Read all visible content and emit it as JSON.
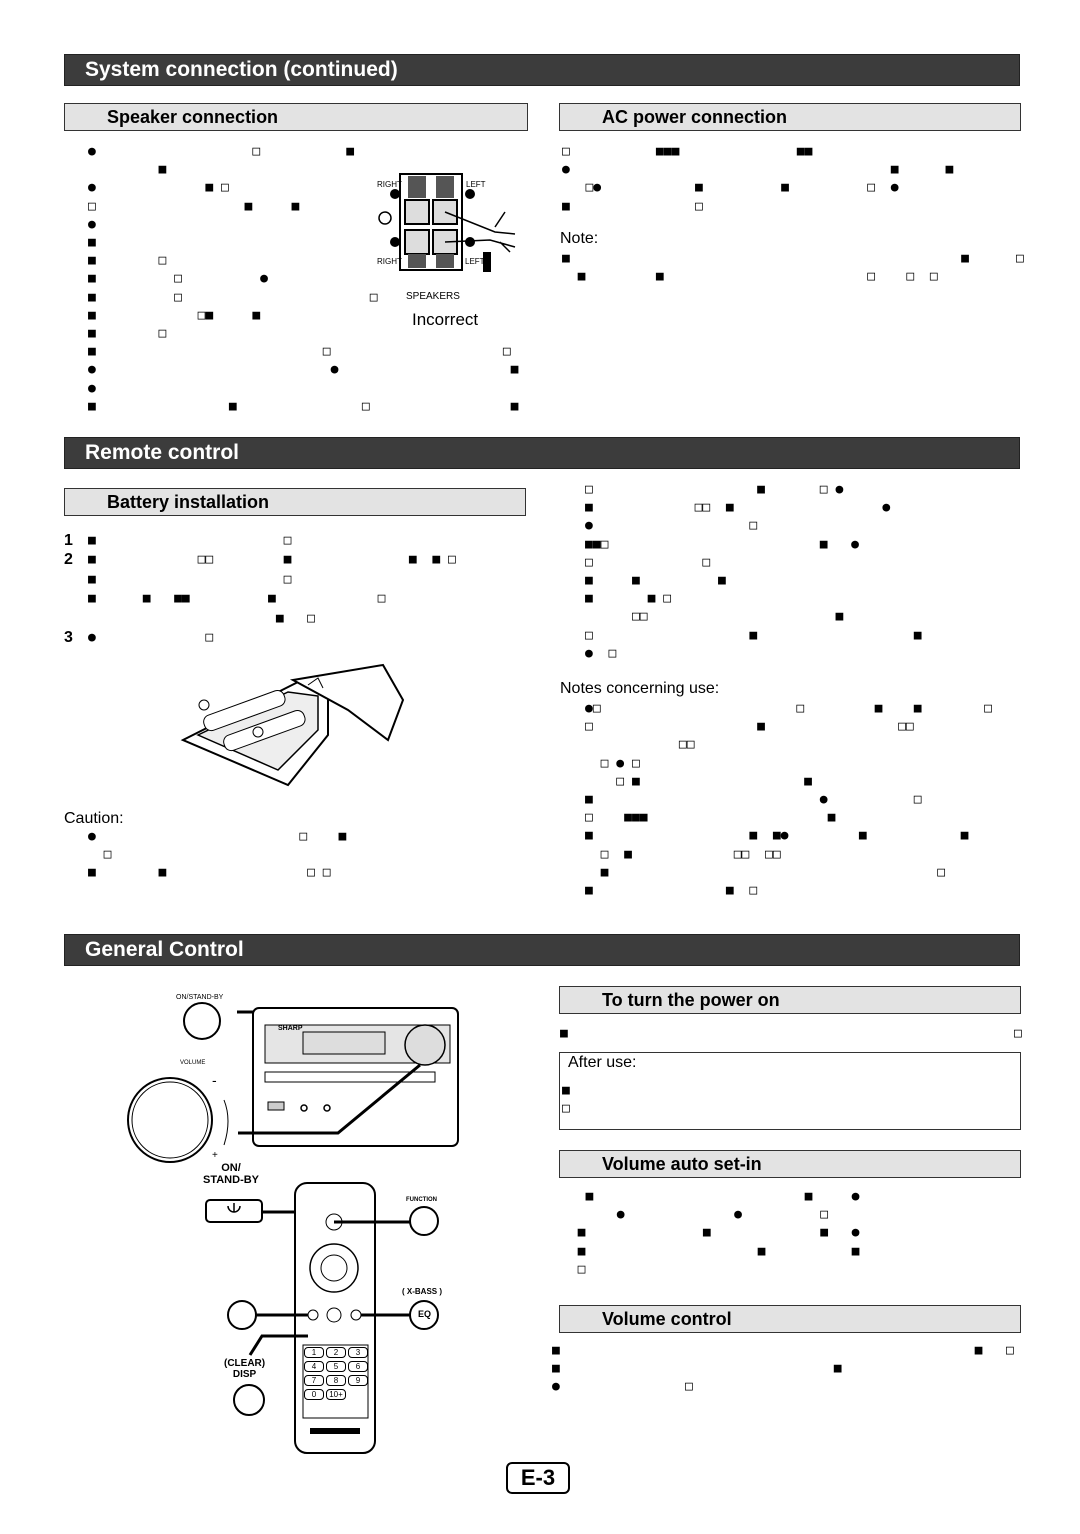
{
  "sections": {
    "system_connection": {
      "title": "System connection (continued)",
      "speaker": {
        "title": "Speaker connection",
        "lines": [
          "●                    □           ■",
          "         ■",
          "●              ■ □",
          "□                   ■     ■",
          "●",
          "■",
          "■        □",
          "■          □          ●",
          "■          □                        □",
          "■             □■     ■",
          "■        □",
          "■                             □                      □",
          "●                              ●                      ■",
          "●",
          "■                 ■                □                  ■"
        ],
        "figure": {
          "right_top": "RIGHT",
          "left_top": "LEFT",
          "right_bottom": "RIGHT",
          "left_bottom": "LEFT",
          "caption": "SPEAKERS",
          "label": "Incorrect"
        }
      },
      "ac_power": {
        "title": "AC power connection",
        "lines": [
          "□           ■■■               ■■",
          "●                                         ■      ■",
          "   □●            ■          ■          □  ●",
          "■                □"
        ],
        "note_label": "Note:",
        "note_lines": [
          "■                                                  ■      □",
          "  ■         ■                          □    □  □"
        ]
      }
    },
    "remote_control": {
      "title": "Remote control",
      "battery": {
        "title": "Battery installation",
        "steps": [
          {
            "n": "1",
            "text": "■                        □"
          },
          {
            "n": "2",
            "text": "■             □□         ■               ■  ■ □"
          },
          {
            "n": "",
            "text": "■                        □"
          },
          {
            "n": "",
            "text": "■      ■   ■■          ■             □"
          },
          {
            "n": "",
            "text": "                        ■   □"
          },
          {
            "n": "3",
            "text": "●              □"
          }
        ],
        "caution_label": "Caution:",
        "caution_lines": [
          "●                          □    ■",
          "  □",
          "■        ■                  □ □"
        ]
      },
      "right_lines": [
        "□                     ■       □ ●",
        "■             □□  ■                   ●",
        "●                    □",
        "■■□                           ■   ●",
        "□              □",
        "■     ■          ■",
        "■       ■ □",
        "      □□                        ■",
        "□                    ■                    ■",
        "●  □"
      ],
      "notes_label": "Notes concerning use:",
      "notes_lines": [
        "●□                         □         ■    ■        □",
        "□                     ■                 □□",
        "            □□",
        "  □ ● □",
        "    □ ■                     ■",
        "■                             ●           □",
        "□    ■■■                       ■",
        "■                    ■  ■●         ■            ■",
        "  □  ■             □□  □□",
        "  ■                                          □",
        "■                 ■  □"
      ]
    },
    "general_control": {
      "title": "General Control",
      "figure": {
        "on_standby": "ON/STAND-BY",
        "volume": "VOLUME",
        "minus": "-",
        "plus": "+",
        "brand": "SHARP",
        "remote_on_standby": "ON/\nSTAND-BY",
        "function": "FUNCTION",
        "xbass": "( X-BASS )",
        "eq": "EQ",
        "clear_disp": "(CLEAR)\nDISP",
        "keypad": [
          "1",
          "2",
          "3",
          "4",
          "5",
          "6",
          "7",
          "8",
          "9",
          "0",
          "10+"
        ]
      },
      "power_on": {
        "title": "To turn the power on",
        "lines": [
          "■                                                         □"
        ],
        "after_use_label": "After use:",
        "after_use_lines": [
          "■",
          "□"
        ]
      },
      "volume_auto": {
        "title": "Volume auto set-in",
        "lines": [
          "   ■                           ■     ●",
          "       ●              ●          □",
          "  ■               ■              ■   ●",
          "  ■                      ■           ■",
          "  □"
        ]
      },
      "volume_control": {
        "title": "Volume control",
        "lines": [
          "■                                                     ■   □",
          "■                                   ■",
          "●                □"
        ]
      }
    }
  },
  "page_number": "E-3"
}
